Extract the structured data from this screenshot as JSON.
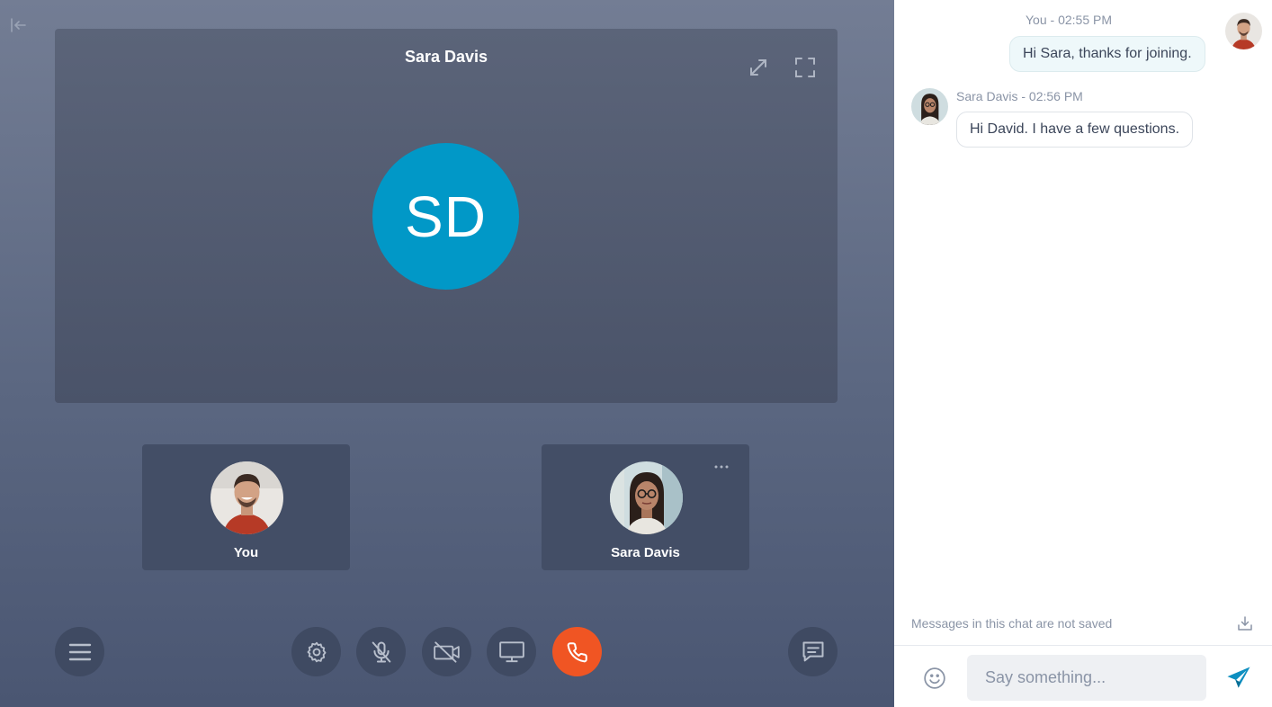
{
  "call": {
    "main_participant": {
      "name": "Sara Davis",
      "initials": "SD",
      "avatar_color": "#0198c7"
    },
    "tiles": [
      {
        "label": "You"
      },
      {
        "label": "Sara Davis"
      }
    ],
    "controls": [
      "menu-icon",
      "settings-icon",
      "mic-off-icon",
      "camera-off-icon",
      "screen-share-icon",
      "hang-up-icon",
      "chat-icon"
    ],
    "hangup_color": "#f05523"
  },
  "chat": {
    "messages": [
      {
        "sender": "You",
        "time": "02:55 PM",
        "meta": "You - 02:55 PM",
        "text": "Hi Sara, thanks for joining."
      },
      {
        "sender": "Sara Davis",
        "time": "02:56 PM",
        "meta": "Sara Davis - 02:56 PM",
        "text": "Hi David. I have a few questions."
      }
    ],
    "notice": "Messages in this chat are not saved",
    "input_placeholder": "Say something...",
    "accent_color": "#0e8fc0"
  }
}
